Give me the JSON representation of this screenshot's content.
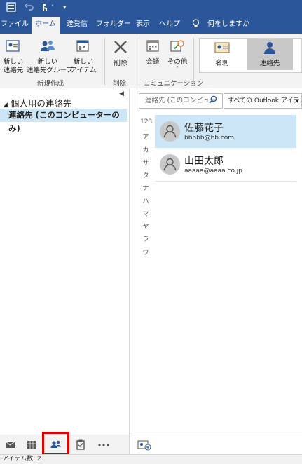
{
  "quick_access": {
    "more": "▾"
  },
  "tabs": [
    "ファイル",
    "ホーム",
    "送受信",
    "フォルダー",
    "表示",
    "ヘルプ"
  ],
  "tell_me": "何をしますか",
  "ribbon": {
    "new_contact": "新しい\n連絡先",
    "new_group": "新しい\n連絡先グループ",
    "new_items": "新しい\nアイテム",
    "group_new": "新規作成",
    "delete": "削除",
    "group_delete": "削除",
    "meeting": "会議",
    "more": "その他",
    "group_communicate": "コミュニケーション",
    "view_card": "名刺",
    "view_contact": "連絡先"
  },
  "nav": {
    "personal_header": "個人用の連絡先",
    "contacts_folder": "連絡先 (このコンピューターのみ)"
  },
  "search": {
    "placeholder": "連絡先 (このコンピュー",
    "scope": "すべての Outlook アイテム"
  },
  "alpha_index": [
    "123",
    "ア",
    "カ",
    "サ",
    "タ",
    "ナ",
    "ハ",
    "マ",
    "ヤ",
    "ラ",
    "ワ"
  ],
  "contacts": [
    {
      "name": "佐藤花子",
      "email": "bbbbb@bb.com"
    },
    {
      "name": "山田太郎",
      "email": "aaaaa@aaaa.co.jp"
    }
  ],
  "status": {
    "item_count": "アイテム数: 2"
  },
  "colors": {
    "brand": "#2b579a",
    "selection": "#cde6f7",
    "highlight_box": "#e00000"
  }
}
